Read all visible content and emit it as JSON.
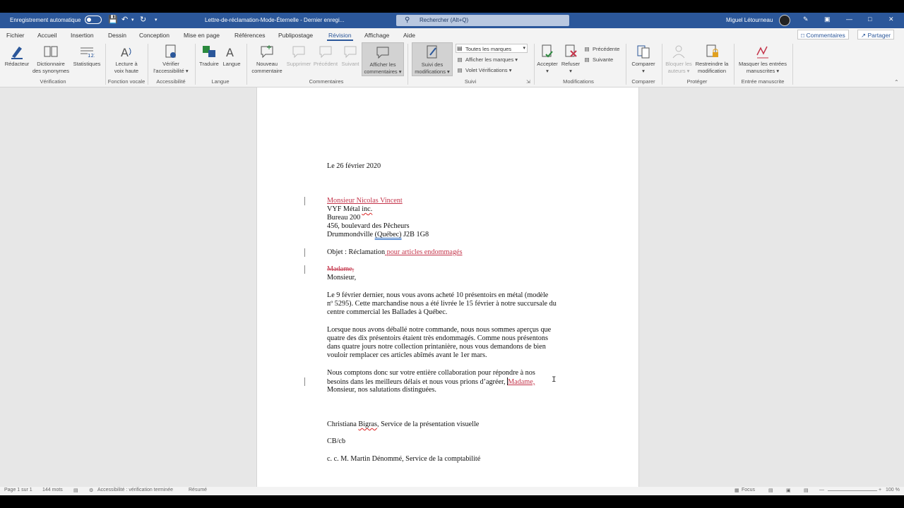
{
  "titlebar": {
    "autosave_label": "Enregistrement automatique",
    "doc_title": "Lettre-de-réclamation-Mode-Éternelle  -  Dernier enregi...",
    "search_placeholder": "Rechercher (Alt+Q)",
    "user_name": "Miguel Létourneau"
  },
  "menu": {
    "items": [
      "Fichier",
      "Accueil",
      "Insertion",
      "Dessin",
      "Conception",
      "Mise en page",
      "Références",
      "Publipostage",
      "Révision",
      "Affichage",
      "Aide"
    ],
    "active": "Révision",
    "comments_button": "Commentaires",
    "share_button": "Partager"
  },
  "ribbon": {
    "verification": {
      "redacteur": "Rédacteur",
      "dictionnaire_1": "Dictionnaire",
      "dictionnaire_2": "des synonymes",
      "statistiques": "Statistiques",
      "group": "Vérification"
    },
    "voice": {
      "lecture_1": "Lecture à",
      "lecture_2": "voix haute",
      "group": "Fonction vocale"
    },
    "accessibility": {
      "verifier_1": "Vérifier",
      "verifier_2": "l'accessibilité ▾",
      "group": "Accessibilité"
    },
    "language": {
      "traduire": "Traduire",
      "langue": "Langue",
      "group": "Langue"
    },
    "comments": {
      "nouveau_1": "Nouveau",
      "nouveau_2": "commentaire",
      "supprimer": "Supprimer",
      "precedent": "Précédent",
      "suivant": "Suivant",
      "afficher_1": "Afficher les",
      "afficher_2": "commentaires ▾",
      "group": "Commentaires"
    },
    "tracking": {
      "suivi_1": "Suivi des",
      "suivi_2": "modifications ▾",
      "combo": "Toutes les marques",
      "afficher_marques": "Afficher les marques ▾",
      "volet": "Volet Vérifications ▾",
      "group": "Suivi"
    },
    "changes": {
      "accepter": "Accepter",
      "refuser": "Refuser",
      "precedente": "Précédente",
      "suivante": "Suivante",
      "group": "Modifications"
    },
    "compare": {
      "comparer": "Comparer",
      "group": "Comparer"
    },
    "protect": {
      "bloquer_1": "Bloquer les",
      "bloquer_2": "auteurs ▾",
      "restreindre_1": "Restreindre la",
      "restreindre_2": "modification",
      "group": "Protéger"
    },
    "ink": {
      "masquer_1": "Masquer les entrées",
      "masquer_2": "manuscrites ▾",
      "group": "Entrée manuscrite"
    }
  },
  "document": {
    "date": "Le 26 février 2020",
    "recipient_name": "Monsieur Nicolas Vincent",
    "company_a": "VYF Métal ",
    "company_b": "inc.",
    "address_1": "Bureau 200",
    "address_2": "456, boulevard des Pêcheurs",
    "city_a": "Drummondville ",
    "city_b": "(Québec)",
    "city_c": "  J2B 1G8",
    "subject_a": "Objet : Réclamation",
    "subject_ins": " pour articles endommagés",
    "salutation_deleted": "Madame,",
    "salutation": "Monsieur,",
    "p1_l1": "Le 9 février dernier, nous vous avons acheté 10 présentoirs en métal (modèle",
    "p1_l2": "nº 5295). Cette marchandise nous a été livrée le 15 février à notre succursale du",
    "p1_l3": "centre commercial les Ballades à Québec.",
    "p2_l1": "Lorsque nous avons déballé notre commande, nous nous sommes aperçus que",
    "p2_l2": "quatre des dix présentoirs étaient très endommagés. Comme nous présentons",
    "p2_l3": "dans quatre jours notre collection printanière, nous vous demandons de bien",
    "p2_l4": "vouloir remplacer ces articles abîmés avant le 1er mars.",
    "p3_l1": "Nous comptons donc sur votre entière collaboration pour répondre à nos",
    "p3_l2a": "besoins dans les meilleurs délais et nous vous prions d’agréer, ",
    "p3_l2b": "Madame,",
    "p3_l3": "Monsieur, nos salutations distinguées.",
    "sig_a": "Christiana ",
    "sig_b": "Bigras",
    "sig_c": ", Service de la présentation visuelle",
    "initials": "CB/cb",
    "cc": "c. c. M. Martin Dénommé, Service de la comptabilité"
  },
  "status": {
    "page": "Page 1 sur 1",
    "words": "144 mots",
    "accessibility": "Accessibilité : vérification terminée",
    "mode": "Résumé",
    "focus": "Focus",
    "zoom": "100 %"
  },
  "colors": {
    "accent": "#2b579a",
    "revision": "#c4344a"
  }
}
